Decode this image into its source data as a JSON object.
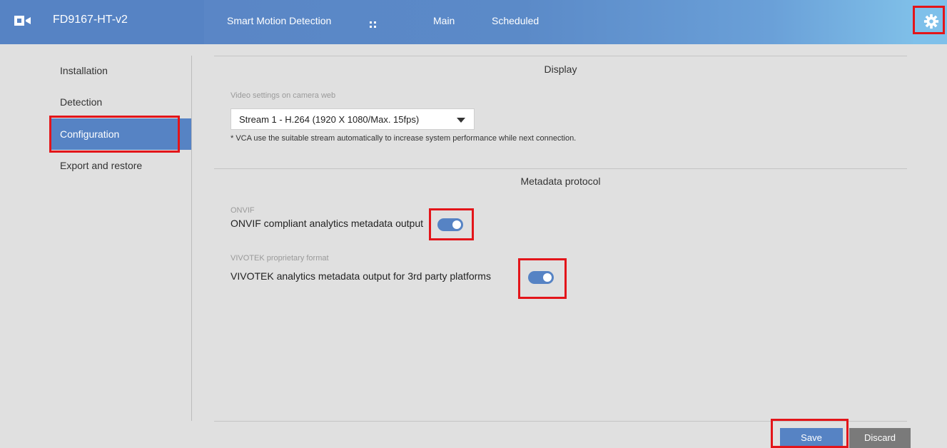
{
  "header": {
    "camera_name": "FD9167-HT-v2",
    "nav": [
      "Smart Motion Detection",
      "Main",
      "Scheduled"
    ],
    "icons": {
      "logo": "vivotek-logo-icon",
      "apps": "grid-icon",
      "settings": "gear-icon"
    }
  },
  "sidebar": {
    "items": [
      {
        "label": "Installation"
      },
      {
        "label": "Detection"
      },
      {
        "label": "Configuration",
        "active": true
      },
      {
        "label": "Export and restore"
      }
    ]
  },
  "display": {
    "title": "Display",
    "video_settings_label": "Video settings on camera web",
    "stream_selected": "Stream 1 - H.264 (1920 X 1080/Max. 15fps)",
    "note": "* VCA use the suitable stream automatically to increase system performance while next connection."
  },
  "metadata": {
    "title": "Metadata protocol",
    "onvif": {
      "category": "ONVIF",
      "label": "ONVIF compliant analytics metadata output",
      "enabled": true
    },
    "vivotek": {
      "category": "VIVOTEK proprietary format",
      "label": "VIVOTEK analytics metadata output for 3rd party platforms",
      "enabled": true
    }
  },
  "actions": {
    "save": "Save",
    "discard": "Discard"
  },
  "colors": {
    "accent": "#5683c4",
    "highlight": "#e3151a",
    "discard": "#7a7a7a"
  }
}
